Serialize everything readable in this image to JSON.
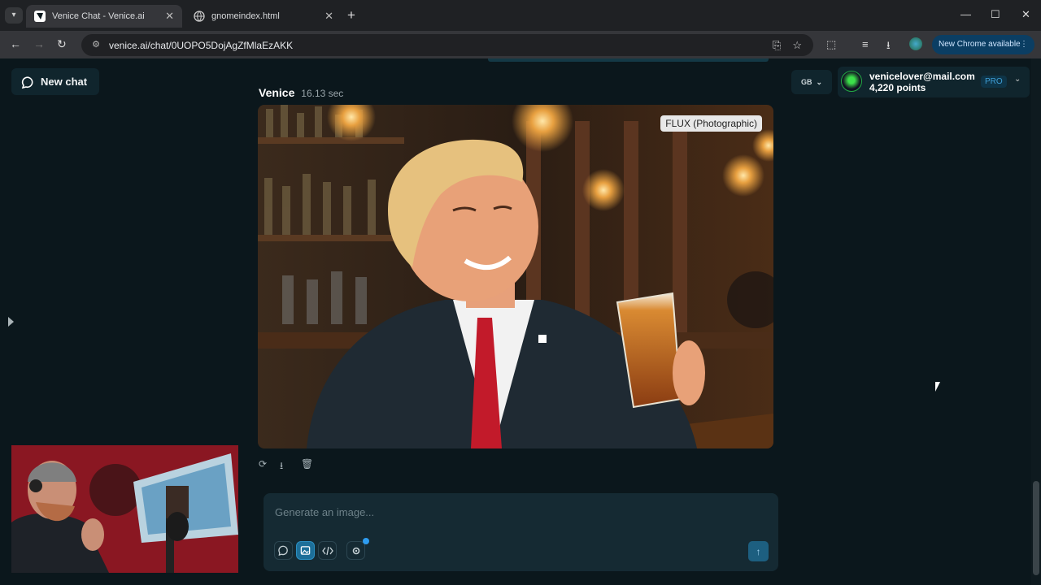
{
  "browser": {
    "tabs": [
      {
        "title": "Venice Chat - Venice.ai",
        "active": true
      },
      {
        "title": "gnomeindex.html",
        "active": false
      }
    ],
    "url": "venice.ai/chat/0UOPO5DojAgZfMlaEzAKK",
    "update_label": "New Chrome available"
  },
  "sidebar": {
    "new_chat_label": "New chat"
  },
  "message": {
    "speaker": "Venice",
    "duration": "16.13 sec",
    "model_badge": "FLUX (Photographic)"
  },
  "composer": {
    "placeholder": "Generate an image..."
  },
  "header": {
    "language": "GB",
    "email": "venicelover@mail.com",
    "points": "4,220 points",
    "plan": "PRO"
  },
  "colors": {
    "app_bg": "#0b171c",
    "accent": "#2e9cf0",
    "panel": "#10252d"
  }
}
